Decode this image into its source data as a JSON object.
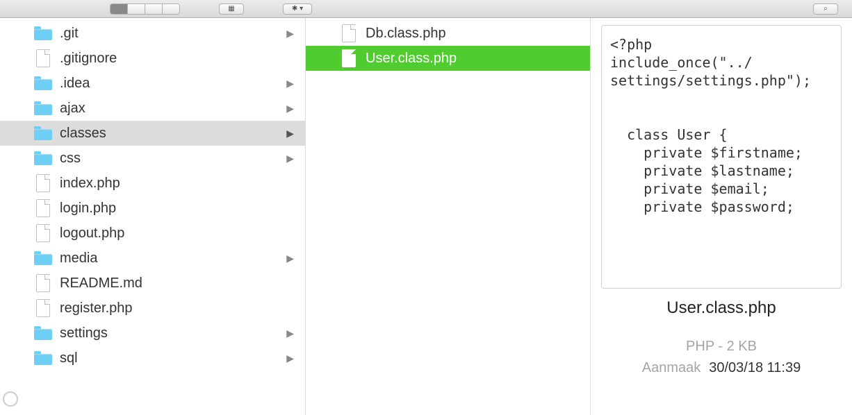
{
  "toolbar": {
    "view_mode": "columns"
  },
  "column1": {
    "items": [
      {
        "name": ".git",
        "type": "folder",
        "expandable": true
      },
      {
        "name": ".gitignore",
        "type": "file",
        "expandable": false
      },
      {
        "name": ".idea",
        "type": "folder",
        "expandable": true
      },
      {
        "name": "ajax",
        "type": "folder",
        "expandable": true
      },
      {
        "name": "classes",
        "type": "folder",
        "expandable": true,
        "selected": true
      },
      {
        "name": "css",
        "type": "folder",
        "expandable": true
      },
      {
        "name": "index.php",
        "type": "file",
        "expandable": false
      },
      {
        "name": "login.php",
        "type": "file",
        "expandable": false
      },
      {
        "name": "logout.php",
        "type": "file",
        "expandable": false
      },
      {
        "name": "media",
        "type": "folder",
        "expandable": true
      },
      {
        "name": "README.md",
        "type": "file",
        "expandable": false
      },
      {
        "name": "register.php",
        "type": "file",
        "expandable": false
      },
      {
        "name": "settings",
        "type": "folder",
        "expandable": true
      },
      {
        "name": "sql",
        "type": "folder",
        "expandable": true
      }
    ]
  },
  "column2": {
    "items": [
      {
        "name": "Db.class.php",
        "type": "file",
        "selected": false
      },
      {
        "name": "User.class.php",
        "type": "file",
        "selected": true
      }
    ]
  },
  "preview": {
    "content": "<?php\ninclude_once(\"../\nsettings/settings.php\");\n\n\n  class User {\n    private $firstname;\n    private $lastname;\n    private $email;\n    private $password;\n\n\n",
    "title": "User.class.php",
    "meta": "PHP - 2 KB",
    "date_label": "Aanmaak",
    "date_value": "30/03/18 11:39"
  }
}
